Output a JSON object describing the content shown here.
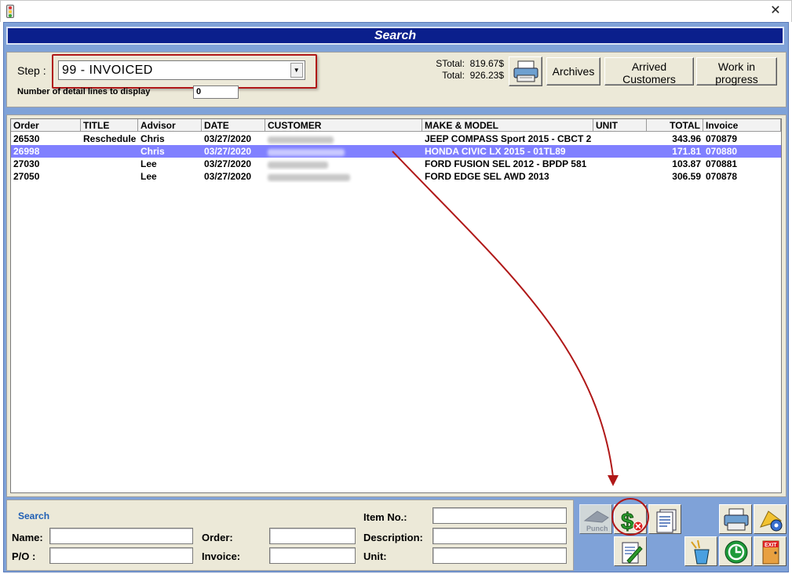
{
  "window": {
    "close_label": "✕"
  },
  "header": {
    "title": "Search"
  },
  "toolbar": {
    "step_label": "Step :",
    "step_value": "99 - INVOICED",
    "detail_lines_label": "Number of detail lines to display",
    "detail_lines_value": "0",
    "stotal_label": "STotal:",
    "stotal_value": "819.67$",
    "total_label": "Total:",
    "total_value": "926.23$",
    "archives_label": "Archives",
    "arrived_line1": "Arrived",
    "arrived_line2": "Customers",
    "work_line1": "Work in",
    "work_line2": "progress"
  },
  "table": {
    "columns": [
      "Order",
      "TITLE",
      "Advisor",
      "DATE",
      "CUSTOMER",
      "MAKE & MODEL",
      "UNIT",
      "TOTAL",
      "Invoice"
    ],
    "rows": [
      {
        "order": "26530",
        "title": "Reschedule",
        "advisor": "Chris",
        "date": "03/27/2020",
        "customer": "Glenda McCoy",
        "make_model": "JEEP COMPASS Sport 2015 - CBCT 2",
        "unit": "",
        "total": "343.96",
        "invoice": "070879",
        "selected": false
      },
      {
        "order": "26998",
        "title": "",
        "advisor": "Chris",
        "date": "03/27/2020",
        "customer": "Glenn Costello",
        "make_model": "HONDA CIVIC LX 2015 - 01TL89",
        "unit": "",
        "total": "171.81",
        "invoice": "070880",
        "selected": true
      },
      {
        "order": "27030",
        "title": "",
        "advisor": "Lee",
        "date": "03/27/2020",
        "customer": "Brenda Love",
        "make_model": "FORD FUSION SEL 2012 - BPDP 581",
        "unit": "",
        "total": "103.87",
        "invoice": "070881",
        "selected": false
      },
      {
        "order": "27050",
        "title": "",
        "advisor": "Lee",
        "date": "03/27/2020",
        "customer": "Tracy MacDonald",
        "make_model": "FORD EDGE SEL AWD 2013",
        "unit": "",
        "total": "306.59",
        "invoice": "070878",
        "selected": false
      }
    ]
  },
  "search": {
    "title": "Search",
    "name_label": "Name:",
    "po_label": "P/O :",
    "order_label": "Order:",
    "invoice_label": "Invoice:",
    "item_label": "Item No.:",
    "description_label": "Description:",
    "unit_label": "Unit:"
  },
  "tools": {
    "punch_label": "Punch",
    "exit_label": "EXIT"
  },
  "colors": {
    "header_bg": "#0b1f8c",
    "selected_row": "#8080ff",
    "highlight_red": "#b01818",
    "frame_blue": "#7fa2d8"
  },
  "icons": [
    "app-icon",
    "close-icon",
    "printer-icon",
    "punch-icon",
    "invoice-dollar-icon",
    "document-icon",
    "edit-icon",
    "printer-settings-icon",
    "settings-icon",
    "clean-icon",
    "go-icon",
    "exit-icon"
  ]
}
